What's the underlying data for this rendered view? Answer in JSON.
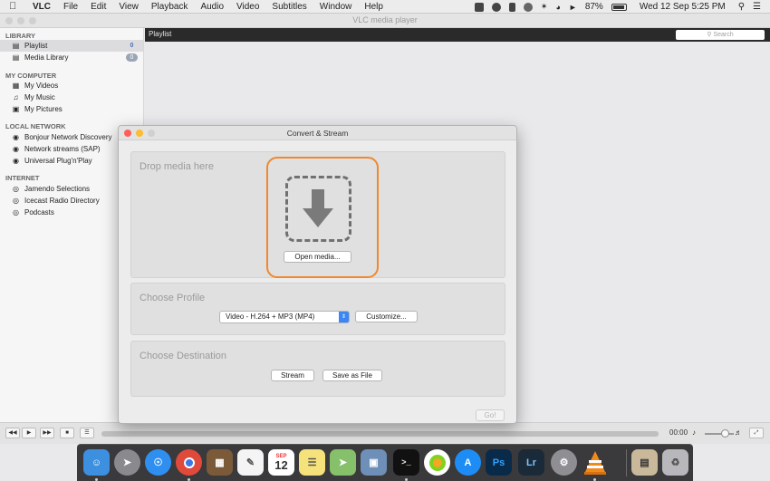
{
  "menubar": {
    "app": "VLC",
    "menus": [
      "File",
      "Edit",
      "View",
      "Playback",
      "Audio",
      "Video",
      "Subtitles",
      "Window",
      "Help"
    ],
    "battery": "87%",
    "clock": "Wed 12 Sep  5:25 PM"
  },
  "vlc": {
    "window_title": "VLC media player",
    "playlist_header": "Playlist",
    "search_placeholder": "Search",
    "time": "00:00"
  },
  "sidebar": {
    "library_heading": "LIBRARY",
    "library": [
      {
        "label": "Playlist",
        "badge": "0"
      },
      {
        "label": "Media Library",
        "badge": "0"
      }
    ],
    "computer_heading": "MY COMPUTER",
    "computer": [
      {
        "label": "My Videos"
      },
      {
        "label": "My Music"
      },
      {
        "label": "My Pictures"
      }
    ],
    "network_heading": "LOCAL NETWORK",
    "network": [
      {
        "label": "Bonjour Network Discovery"
      },
      {
        "label": "Network streams (SAP)"
      },
      {
        "label": "Universal Plug'n'Play"
      }
    ],
    "internet_heading": "INTERNET",
    "internet": [
      {
        "label": "Jamendo Selections"
      },
      {
        "label": "Icecast Radio Directory"
      },
      {
        "label": "Podcasts"
      }
    ]
  },
  "dialog": {
    "title": "Convert & Stream",
    "drop_heading": "Drop media here",
    "open_media": "Open media...",
    "profile_heading": "Choose Profile",
    "profile_selected": "Video - H.264 + MP3 (MP4)",
    "customize": "Customize...",
    "destination_heading": "Choose Destination",
    "stream": "Stream",
    "save_as_file": "Save as File",
    "go": "Go!"
  },
  "dock": {
    "calendar_day": "12",
    "calendar_month": "SEP",
    "terminal": ">_",
    "ps": "Ps",
    "lr": "Lr"
  },
  "colors": {
    "accent_orange": "#f0882e",
    "select_blue": "#3a86f5",
    "close": "#fd5f57",
    "minimize": "#febc2e"
  }
}
